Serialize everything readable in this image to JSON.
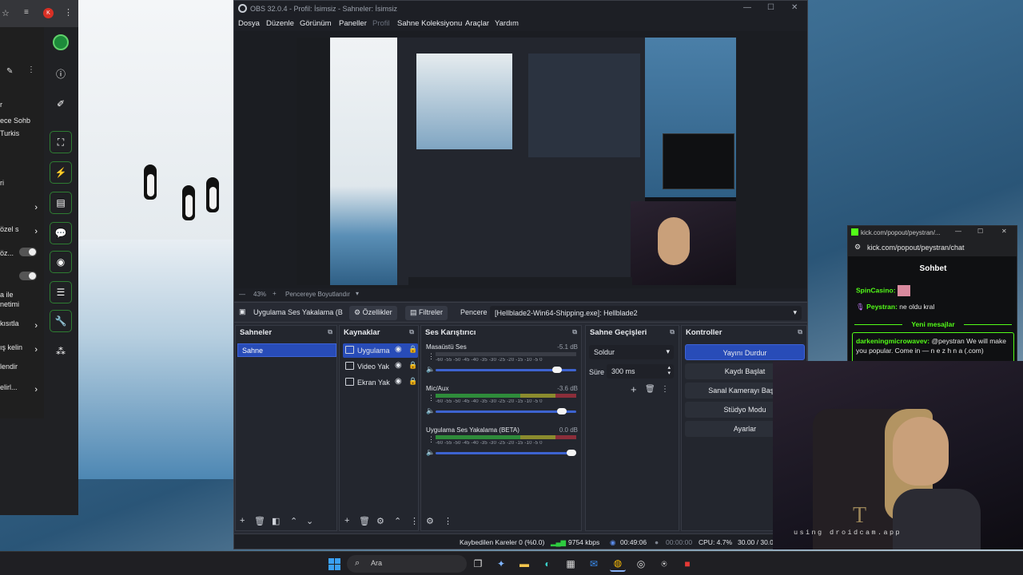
{
  "left_browser": {
    "panel_rows": [
      {
        "text": "r",
        "chevron": false
      },
      {
        "text": "ece Sohb",
        "chevron": false
      },
      {
        "text": "Turkis",
        "chevron": false
      },
      {
        "text": "ri",
        "chevron": false
      },
      {
        "text": "",
        "chevron": true
      },
      {
        "text": "özel s",
        "chevron": true
      },
      {
        "text": "öz...",
        "chevron": false
      },
      {
        "text": "",
        "chevron": false
      },
      {
        "text": "a ile",
        "chevron": false
      },
      {
        "text": "netimi",
        "chevron": false
      },
      {
        "text": "kısıtla",
        "chevron": true
      },
      {
        "text": "ış kelin",
        "chevron": true
      },
      {
        "text": "lendir",
        "chevron": false
      },
      {
        "text": "elirl...",
        "chevron": true
      }
    ],
    "tab_badge": "K"
  },
  "obs": {
    "title": "OBS 32.0.4 - Profil: İsimsiz - Sahneler: İsimsiz",
    "menu": [
      "Dosya",
      "Düzenle",
      "Görünüm",
      "Paneller",
      "Profil",
      "Sahne Koleksiyonu",
      "Araçlar",
      "Yardım"
    ],
    "zoom": "43%",
    "preview_mode": "Pencereye Boyutlandır",
    "source_toolbar": {
      "source_name": "Uygulama Ses Yakalama (B",
      "properties": "Özellikler",
      "filters": "Filtreler",
      "window_label": "Pencere",
      "window_value": "[Hellblade2-Win64-Shipping.exe]: Hellblade2"
    },
    "docks": {
      "scenes_title": "Sahneler",
      "sources_title": "Kaynaklar",
      "mixer_title": "Ses Karıştırıcı",
      "transitions_title": "Sahne Geçişleri",
      "controls_title": "Kontroller"
    },
    "scenes": [
      "Sahne"
    ],
    "sources": [
      {
        "name": "Uygulama",
        "active": true
      },
      {
        "name": "Video Yak",
        "active": false
      },
      {
        "name": "Ekran Yak",
        "active": false
      }
    ],
    "mixer": [
      {
        "name": "Masaüstü Ses",
        "db": "-5.1 dB",
        "level": 0.0,
        "volume": 0.9
      },
      {
        "name": "Mic/Aux",
        "db": "-3.6 dB",
        "level": 1.0,
        "volume": 0.93
      },
      {
        "name": "Uygulama Ses Yakalama (BETA)",
        "db": "0.0 dB",
        "level": 1.0,
        "volume": 1.0
      }
    ],
    "mixer_ticks": "-60 -55 -50 -45 -40 -35 -30 -25 -20 -15 -10 -5 0",
    "transitions": {
      "type": "Soldur",
      "duration_label": "Süre",
      "duration": "300 ms"
    },
    "controls": [
      "Yayını Durdur",
      "Kaydı Başlat",
      "Sanal Kamerayı Başlat",
      "Stüdyo Modu",
      "Ayarlar"
    ],
    "status": {
      "dropped": "Kaybedilen Kareler 0 (%0.0)",
      "bitrate": "9754 kbps",
      "stream_time": "00:49:06",
      "rec_time": "00:00:00",
      "cpu": "CPU: 4.7%",
      "fps": "30.00 / 30.00"
    }
  },
  "kick": {
    "url_short": "kick.com/popout/peystran/...",
    "url": "kick.com/popout/peystran/chat",
    "chat_title": "Sohbet",
    "messages": [
      {
        "user": "SpinCasino:",
        "text": ""
      },
      {
        "user": "Peystran:",
        "text": "ne oldu kral"
      }
    ],
    "new_messages": "Yeni mesajlar",
    "highlight": {
      "user": "darkeningmicrowavev:",
      "text": "@peystran We will make you popular. Come in — n e z h n a (.com)"
    }
  },
  "webcam": {
    "watermark": "using droidcam.app"
  },
  "taskbar": {
    "search_placeholder": "Ara"
  },
  "colors": {
    "accent": "#284cb8",
    "kick_green": "#53fc18",
    "obs_bg": "#272a33"
  }
}
